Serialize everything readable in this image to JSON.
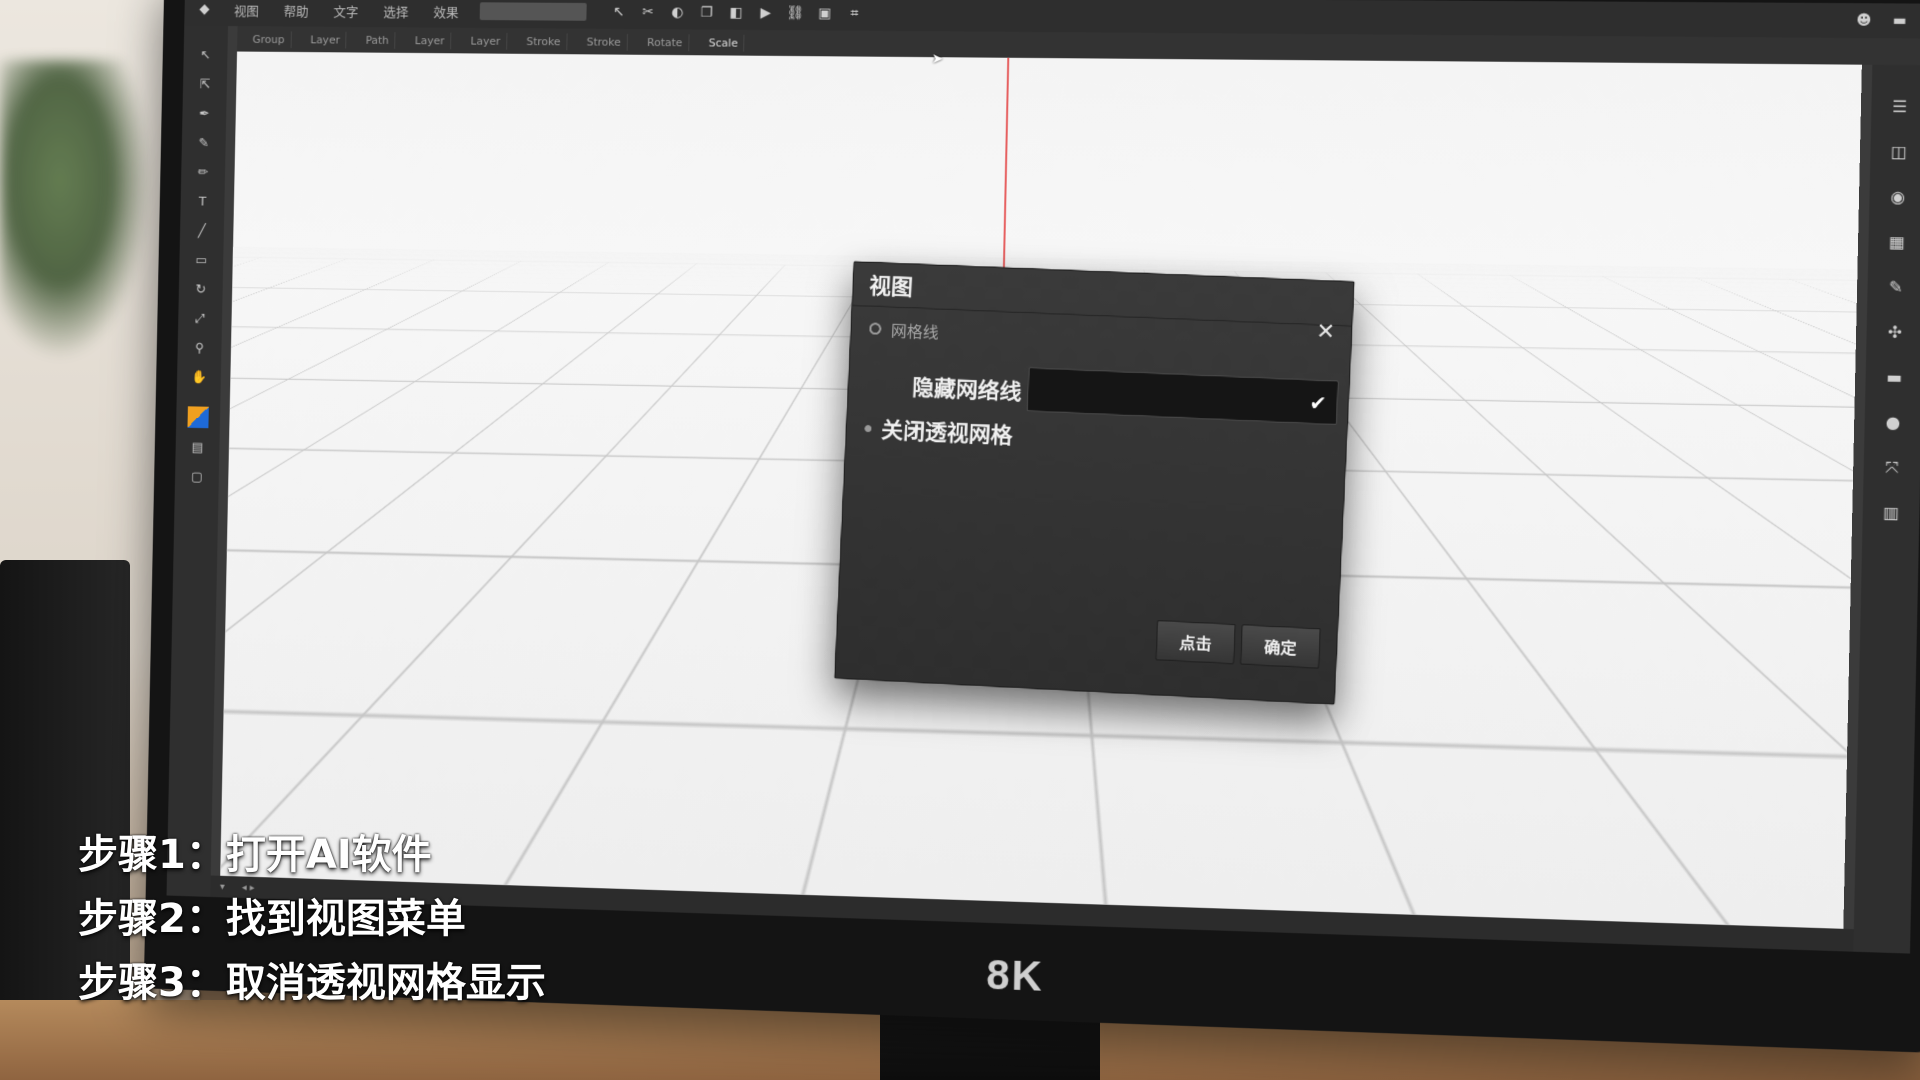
{
  "menu": {
    "items": [
      "视图",
      "帮助",
      "文字",
      "选择",
      "效果"
    ]
  },
  "toolbar": {
    "icons": [
      "arrow-icon",
      "cut-icon",
      "shape-icon",
      "copy-icon",
      "play-icon",
      "link-icon",
      "image-icon",
      "crop-icon"
    ]
  },
  "tabs": [
    "Group",
    "Layer",
    "Path",
    "Layer",
    "Layer",
    "Stroke",
    "Stroke",
    "Rotate",
    "Scale"
  ],
  "dialog": {
    "title": "视图",
    "grid_option_label": "网格线",
    "hide_gridlines_label": "隐藏网络线",
    "dropdown_value": "",
    "close_perspective_label": "关闭透视网格",
    "click_button": "点击",
    "ok_button": "确定"
  },
  "monitor": {
    "brand": "8K"
  },
  "steps": {
    "step1": "步骤1：打开AI软件",
    "step2": "步骤2：找到视图菜单",
    "step3": "步骤3：取消透视网格显示"
  },
  "colors": {
    "dialog_bg": "#333333",
    "guide_line": "#e23a3a",
    "canvas_bg": "#f4f4f4"
  }
}
